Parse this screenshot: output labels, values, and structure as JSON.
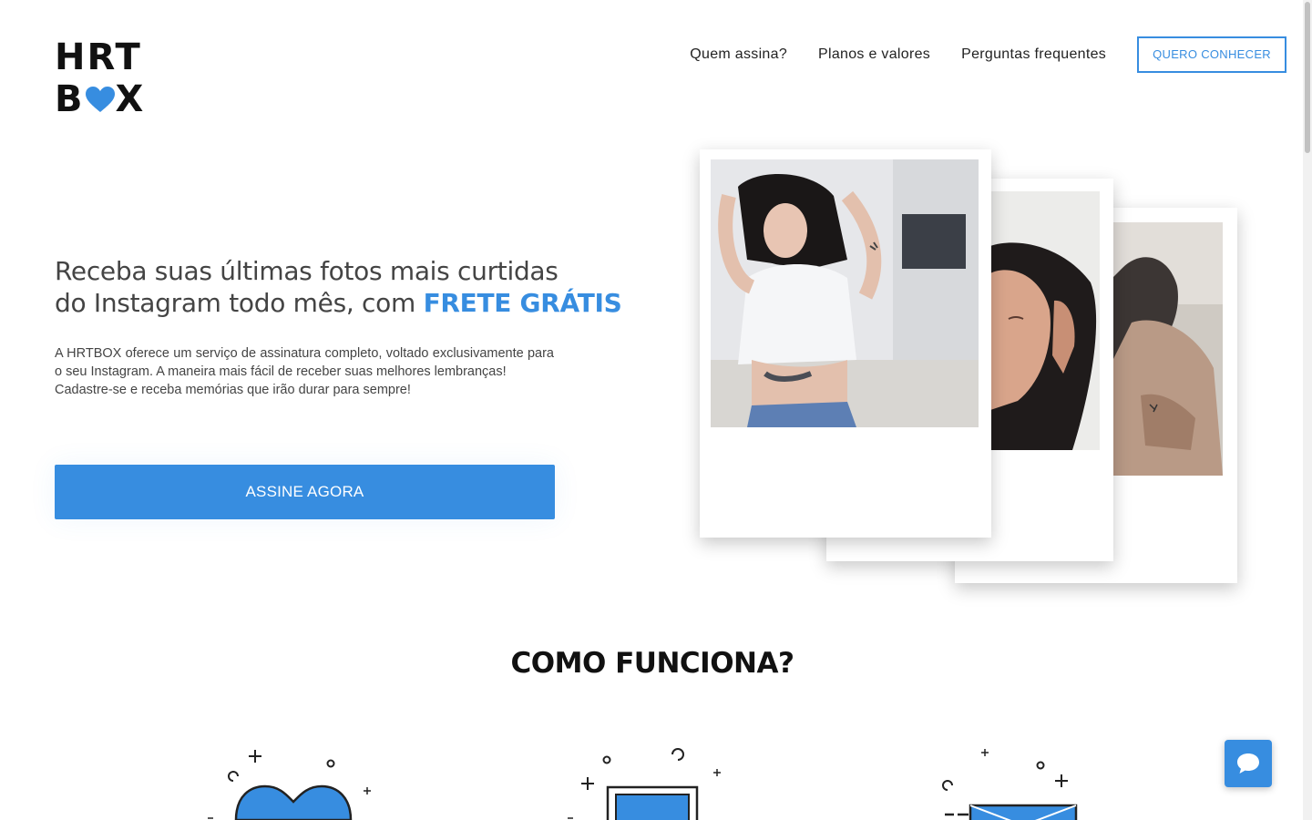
{
  "logo": {
    "line1": "HRT",
    "line2_left": "B",
    "line2_right": "X"
  },
  "nav": {
    "items": [
      "Quem assina?",
      "Planos e valores",
      "Perguntas frequentes"
    ],
    "cta": "QUERO CONHECER"
  },
  "hero": {
    "headline_line1": "Receba suas últimas fotos mais curtidas",
    "headline_line2": "do Instagram todo mês, com ",
    "headline_accent": "FRETE GRÁTIS",
    "description_line1": "A HRTBOX oferece um serviço de assinatura completo, voltado exclusivamente para o seu Instagram. A maneira mais fácil de receber suas melhores lembranças!",
    "description_line2": "Cadastre-se e receba memórias que irão durar para sempre!",
    "cta": "ASSINE AGORA"
  },
  "section": {
    "title": "COMO FUNCIONA?"
  },
  "colors": {
    "accent": "#378de0",
    "text": "#444444",
    "heading": "#111111"
  },
  "icons": [
    "heart-icon",
    "chat-icon"
  ]
}
